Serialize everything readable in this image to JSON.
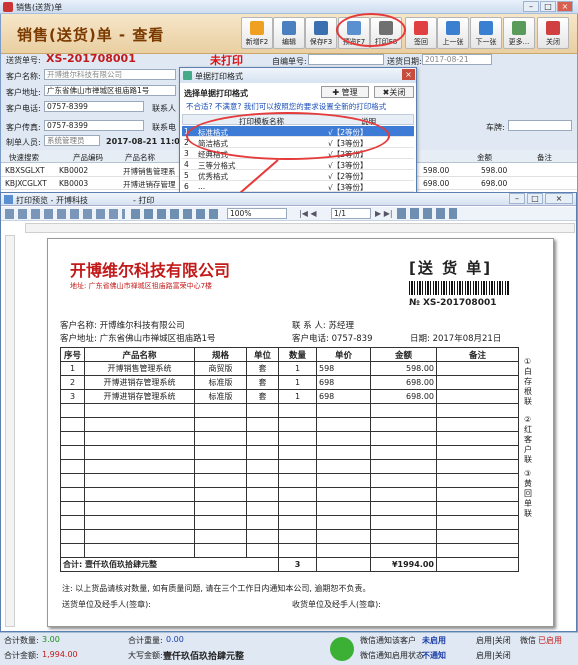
{
  "window": {
    "title": "销售(送货)单"
  },
  "header": {
    "title": "销售(送货)单 - 查看"
  },
  "toolbar": [
    {
      "label": "新增F2",
      "icon": "new-doc-icon",
      "color": "#f0a020"
    },
    {
      "label": "编辑",
      "icon": "edit-icon",
      "color": "#4a7fc0"
    },
    {
      "label": "保存F3",
      "icon": "save-icon",
      "color": "#3a6fb0"
    },
    {
      "label": "预览F7",
      "icon": "preview-icon",
      "color": "#5a8fd0"
    },
    {
      "label": "打印F8",
      "icon": "printer-icon",
      "color": "#707070"
    },
    {
      "label": "签回",
      "icon": "check-icon",
      "color": "#e04040"
    },
    {
      "label": "上一张",
      "icon": "prev-icon",
      "color": "#3a7fd0"
    },
    {
      "label": "下一张",
      "icon": "next-icon",
      "color": "#3a7fd0"
    },
    {
      "label": "更多...",
      "icon": "more-icon",
      "color": "#5a9a5a"
    },
    {
      "label": "关闭",
      "icon": "close-icon",
      "color": "#d04040"
    }
  ],
  "form": {
    "order_no_label": "送货单号:",
    "order_no": "XS-201708001",
    "print_status": "未打印",
    "self_no_label": "自编单号:",
    "date_label": "送货日期:",
    "date": "2017-08-21",
    "customer_label": "客户名称:",
    "customer": "开博维尔科技有限公司",
    "address_label": "客户地址:",
    "address": "广东省佛山市禅城区祖庙路1号",
    "phone_label": "客户电话:",
    "phone": "0757-8399",
    "contact_label": "联系人",
    "fax_label": "客户传真:",
    "fax": "0757-8399",
    "contact2_label": "联系电",
    "plate_label": "车牌:",
    "maker_label": "制单人员:",
    "maker": "系统管理员",
    "make_time": "2017-08-21 11:08:"
  },
  "grid": {
    "headers": [
      "快速搜索",
      "产品编码",
      "产品名称",
      "金额",
      "备注"
    ],
    "rows": [
      {
        "search": "KBXSGLXT",
        "code": "KB0002",
        "name": "开博销售管理系",
        "amount": "598.00",
        "amount2": "598.00"
      },
      {
        "search": "KBJXCGLXT",
        "code": "KB0003",
        "name": "开博进销存管理",
        "amount": "698.00",
        "amount2": "698.00"
      }
    ]
  },
  "popup": {
    "title": "单据打印格式",
    "heading": "选择单据打印格式",
    "manage_label": "管理",
    "close_label": "关闭",
    "hint": "不合适? 不满意? 我们可以按照您的要求设置全新的打印格式",
    "col_template": "打印模板名称",
    "col_desc": "说明",
    "rows": [
      {
        "no": "1",
        "name": "标准格式",
        "desc": "√【2等份】"
      },
      {
        "no": "2",
        "name": "简洁格式",
        "desc": "√【3等份】"
      },
      {
        "no": "3",
        "name": "经典格式",
        "desc": "√【2等份】"
      },
      {
        "no": "4",
        "name": "三等分格式",
        "desc": "√【3等份】"
      },
      {
        "no": "5",
        "name": "优秀格式",
        "desc": "√【2等份】"
      },
      {
        "no": "6",
        "name": "...",
        "desc": "√【3等份】"
      }
    ]
  },
  "preview": {
    "title": "打印预览 - 开博科技",
    "title_suffix": "- 打印",
    "zoom": "100%",
    "page": "1/1",
    "company": "开博维尔科技有限公司",
    "company_addr": "地址: 广东省佛山市禅城区祖庙路富荣中心7楼",
    "doc_title": "[送 货 单]",
    "doc_no": "№ XS-201708001",
    "cust_name": "客户名称: 开博维尔科技有限公司",
    "cust_addr": "客户地址: 广东省佛山市禅城区祖庙路1号",
    "contact": "联 系 人: 苏经理",
    "cust_phone": "客户电话: 0757-839",
    "date": "日期: 2017年08月21日",
    "cols": [
      "序号",
      "产品名称",
      "规格",
      "单位",
      "数量",
      "单价",
      "金额",
      "备注"
    ],
    "rows": [
      {
        "no": "1",
        "name": "开博销售管理系统",
        "spec": "商贸版",
        "unit": "套",
        "qty": "1",
        "price": "598",
        "amount": "598.00",
        "note": ""
      },
      {
        "no": "2",
        "name": "开博进销存管理系统",
        "spec": "标准版",
        "unit": "套",
        "qty": "1",
        "price": "698",
        "amount": "698.00",
        "note": ""
      },
      {
        "no": "3",
        "name": "开博进销存管理系统",
        "spec": "标准版",
        "unit": "套",
        "qty": "1",
        "price": "698",
        "amount": "698.00",
        "note": ""
      }
    ],
    "total_label": "合计: 壹仟玖佰玖拾肆元整",
    "total_qty": "3",
    "total_amount": "¥1994.00",
    "note": "注: 以上货品请核对数量, 如有质量问题, 请在三个工作日内通知本公司, 逾期恕不负责。",
    "sender": "送货单位及经手人(签章):",
    "receiver": "收货单位及经手人(签章):",
    "side_1": "①白存根联",
    "side_2": "②红客户联",
    "side_3": "③黄回单联"
  },
  "status": {
    "total_qty_label": "合计数量:",
    "total_qty": "3.00",
    "total_amount_label": "合计金额:",
    "total_amount": "1,994.00",
    "total_weight_label": "合计重量:",
    "total_weight": "0.00",
    "caps_label": "大写金额:",
    "caps": "壹仟玖佰玖拾肆元整",
    "wechat_customer": "微信通知该客户",
    "wechat_customer_state": "未启用",
    "wechat_status": "微信通知启用状态",
    "wechat_status_state": "不通知",
    "toggle1": "启用|关闭",
    "toggle2": "启用|关闭",
    "wechat_state": "微信",
    "wechat_state_val": "已启用"
  }
}
